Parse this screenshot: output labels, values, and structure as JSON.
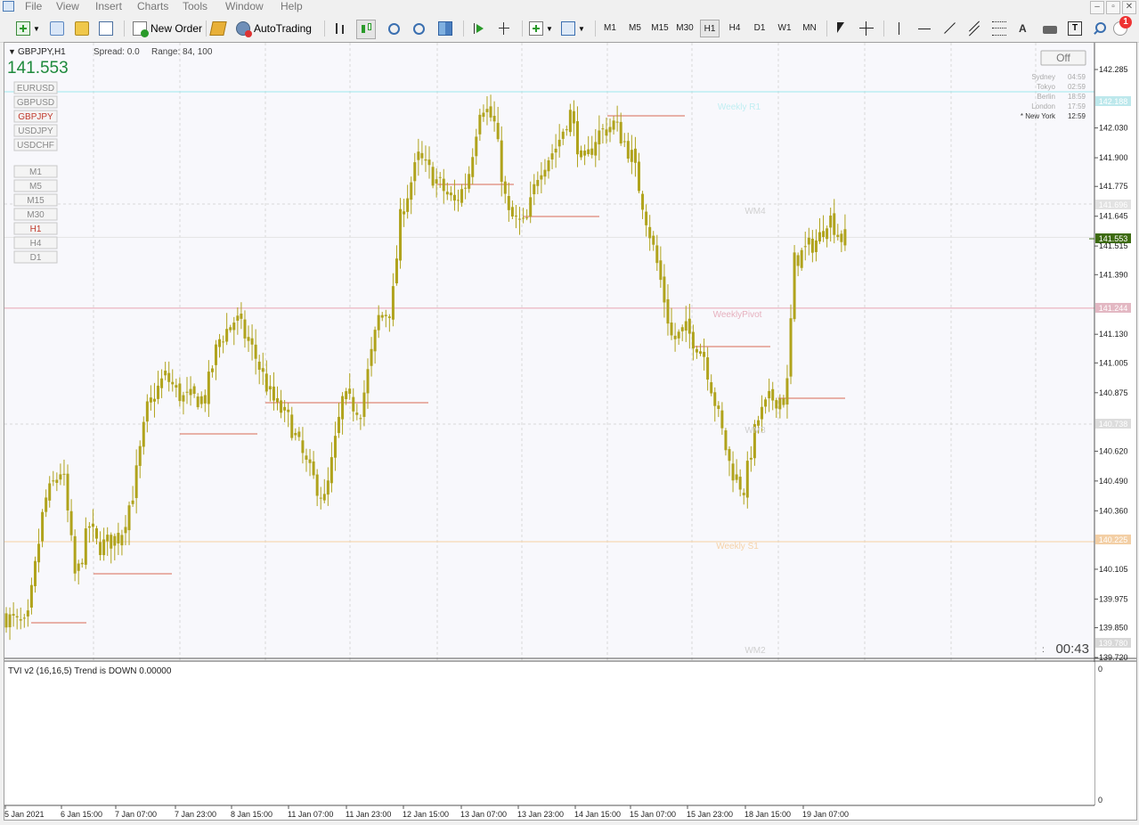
{
  "menu": [
    "File",
    "View",
    "Insert",
    "Charts",
    "Tools",
    "Window",
    "Help"
  ],
  "window_controls": [
    "–",
    "▫",
    "✕"
  ],
  "toolbar": {
    "new_order": "New Order",
    "autotrading": "AutoTrading",
    "timeframes": [
      "M1",
      "M5",
      "M15",
      "M30",
      "H1",
      "H4",
      "D1",
      "W1",
      "MN"
    ],
    "active_timeframe": "H1",
    "notification_count": "1",
    "text_tool": "A"
  },
  "chart": {
    "symbol": "GBPJPY,H1",
    "bid": "141.553",
    "spread": "Spread: 0.0",
    "range": "Range: 84, 100",
    "off_button": "Off",
    "countdown": "00:43",
    "symbols": [
      "EURUSD",
      "GBPUSD",
      "GBPJPY",
      "USDJPY",
      "USDCHF"
    ],
    "active_symbol": "GBPJPY",
    "tf_buttons": [
      "M1",
      "M5",
      "M15",
      "M30",
      "H1",
      "H4",
      "D1"
    ],
    "active_tf_button": "H1",
    "sessions": [
      {
        "city": "Sydney",
        "time": "04:59"
      },
      {
        "city": "Tokyo",
        "time": "02:59"
      },
      {
        "city": "Berlin",
        "time": "18:59"
      },
      {
        "city": "London",
        "time": "17:59"
      },
      {
        "city": "* New York",
        "time": "12:59"
      }
    ],
    "level_labels": [
      "Weekly R1",
      "WM4",
      "WeeklyPivot",
      "WM3",
      "Weekly S1",
      "WM2"
    ],
    "price_ticks": [
      "142.285",
      "142.030",
      "141.900",
      "141.775",
      "141.645",
      "141.515",
      "141.390",
      "141.130",
      "141.005",
      "140.875",
      "140.620",
      "140.490",
      "140.360",
      "140.105",
      "139.975",
      "139.850",
      "139.720"
    ],
    "price_tags": {
      "r1": "142.188",
      "wm4": "141.696",
      "pivot": "141.244",
      "wm3": "140.738",
      "s1": "140.225",
      "wm2": "139.780",
      "current": "141.553"
    },
    "time_labels": [
      "5 Jan 2021",
      "6 Jan 15:00",
      "7 Jan 07:00",
      "7 Jan 23:00",
      "8 Jan 15:00",
      "11 Jan 07:00",
      "11 Jan 23:00",
      "12 Jan 15:00",
      "13 Jan 07:00",
      "13 Jan 23:00",
      "14 Jan 15:00",
      "15 Jan 07:00",
      "15 Jan 23:00",
      "18 Jan 15:00",
      "19 Jan 07:00"
    ],
    "colors": {
      "candle": "#b0a31c",
      "bid": "#1e8a3c",
      "level_line": "#d96a55",
      "r1": "#9ee8ee",
      "pivot": "#e8a5b3",
      "s1": "#f6cfa2",
      "grid": "#d8d8d8",
      "current_tag": "#3d6b10"
    }
  },
  "indicator": {
    "title": "TVI v2 (16,16,5) Trend is DOWN 0.00000",
    "scale_top": "0",
    "scale_bottom": "0"
  },
  "chart_data": {
    "type": "candlestick",
    "symbol": "GBPJPY",
    "timeframe": "H1",
    "ylim": [
      139.72,
      142.3
    ],
    "horizontal_levels": [
      {
        "name": "Weekly R1",
        "value": 142.188
      },
      {
        "name": "WM4",
        "value": 141.696
      },
      {
        "name": "WeeklyPivot",
        "value": 141.244
      },
      {
        "name": "WM3",
        "value": 140.738
      },
      {
        "name": "Weekly S1",
        "value": 140.225
      },
      {
        "name": "WM2",
        "value": 139.78
      }
    ],
    "current_price": 141.553,
    "close_path": [
      {
        "x": 0,
        "y": 139.9
      },
      {
        "x": 25,
        "y": 139.85
      },
      {
        "x": 45,
        "y": 140.4
      },
      {
        "x": 65,
        "y": 140.55
      },
      {
        "x": 80,
        "y": 140.05
      },
      {
        "x": 95,
        "y": 140.3
      },
      {
        "x": 105,
        "y": 140.2
      },
      {
        "x": 130,
        "y": 140.25
      },
      {
        "x": 145,
        "y": 140.45
      },
      {
        "x": 160,
        "y": 140.8
      },
      {
        "x": 180,
        "y": 140.95
      },
      {
        "x": 200,
        "y": 140.85
      },
      {
        "x": 225,
        "y": 140.85
      },
      {
        "x": 240,
        "y": 141.1
      },
      {
        "x": 260,
        "y": 141.2
      },
      {
        "x": 280,
        "y": 141.05
      },
      {
        "x": 300,
        "y": 140.85
      },
      {
        "x": 320,
        "y": 140.75
      },
      {
        "x": 340,
        "y": 140.55
      },
      {
        "x": 360,
        "y": 140.4
      },
      {
        "x": 380,
        "y": 140.85
      },
      {
        "x": 400,
        "y": 140.8
      },
      {
        "x": 420,
        "y": 141.2
      },
      {
        "x": 435,
        "y": 141.25
      },
      {
        "x": 445,
        "y": 141.65
      },
      {
        "x": 465,
        "y": 141.9
      },
      {
        "x": 485,
        "y": 141.8
      },
      {
        "x": 505,
        "y": 141.7
      },
      {
        "x": 520,
        "y": 141.8
      },
      {
        "x": 535,
        "y": 142.15
      },
      {
        "x": 550,
        "y": 142.05
      },
      {
        "x": 565,
        "y": 141.65
      },
      {
        "x": 585,
        "y": 141.6
      },
      {
        "x": 600,
        "y": 141.85
      },
      {
        "x": 620,
        "y": 141.95
      },
      {
        "x": 635,
        "y": 142.1
      },
      {
        "x": 650,
        "y": 141.85
      },
      {
        "x": 665,
        "y": 142.0
      },
      {
        "x": 685,
        "y": 142.05
      },
      {
        "x": 705,
        "y": 141.9
      },
      {
        "x": 720,
        "y": 141.65
      },
      {
        "x": 735,
        "y": 141.4
      },
      {
        "x": 750,
        "y": 141.1
      },
      {
        "x": 765,
        "y": 141.15
      },
      {
        "x": 785,
        "y": 141.05
      },
      {
        "x": 800,
        "y": 140.8
      },
      {
        "x": 815,
        "y": 140.55
      },
      {
        "x": 830,
        "y": 140.45
      },
      {
        "x": 845,
        "y": 140.75
      },
      {
        "x": 860,
        "y": 140.85
      },
      {
        "x": 878,
        "y": 140.85
      },
      {
        "x": 887,
        "y": 141.45
      },
      {
        "x": 900,
        "y": 141.5
      },
      {
        "x": 915,
        "y": 141.55
      },
      {
        "x": 925,
        "y": 141.65
      },
      {
        "x": 940,
        "y": 141.55
      },
      {
        "x": 946,
        "y": 141.55
      }
    ]
  }
}
